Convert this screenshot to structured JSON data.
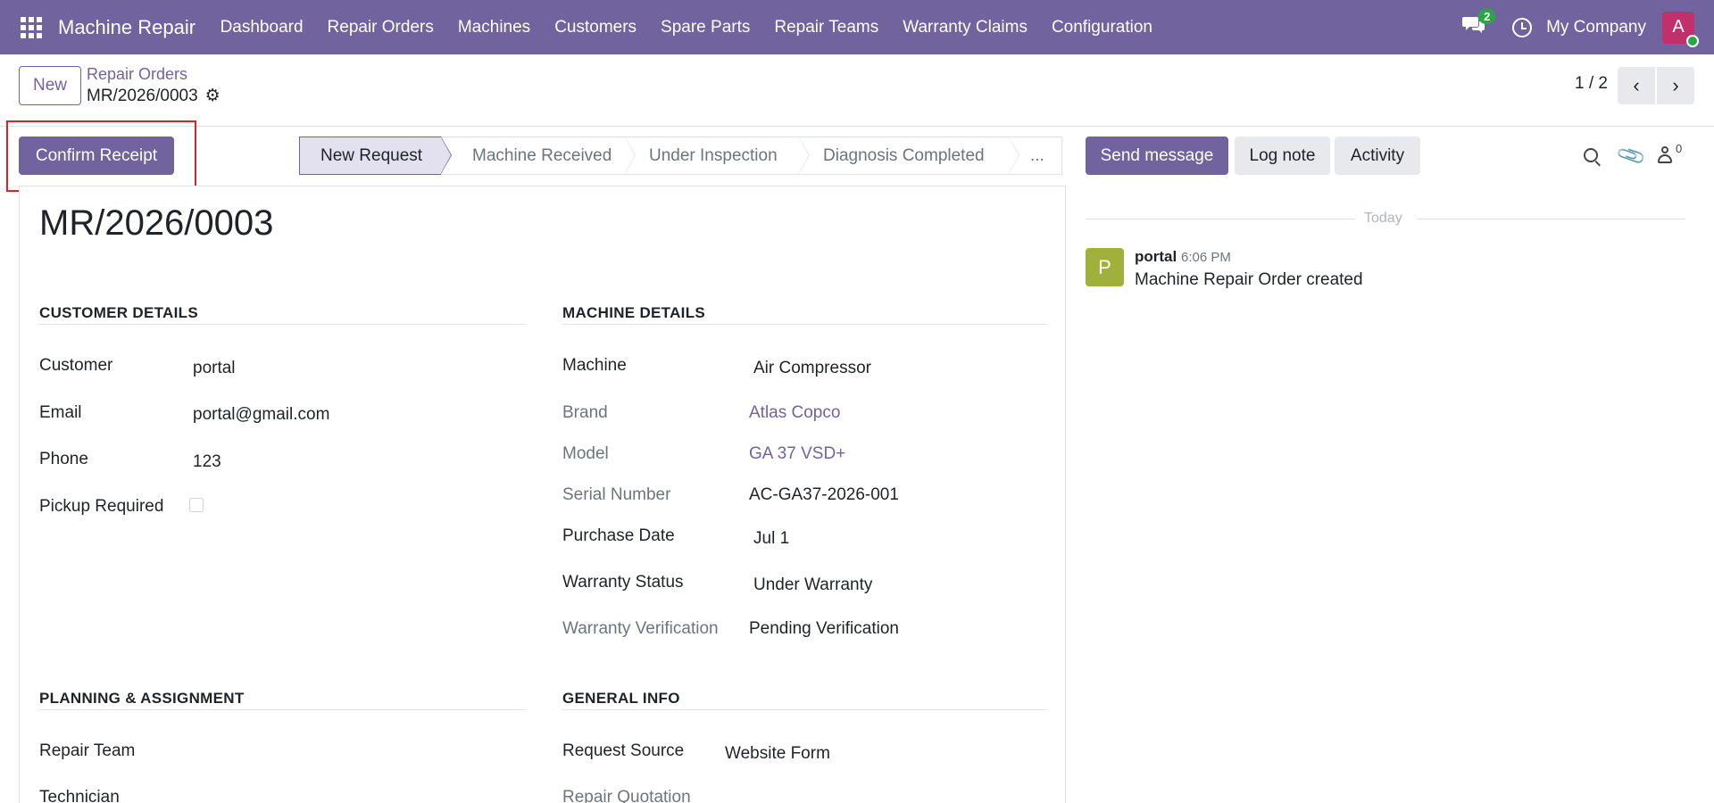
{
  "navbar": {
    "brand": "Machine Repair",
    "menu": [
      "Dashboard",
      "Repair Orders",
      "Machines",
      "Customers",
      "Spare Parts",
      "Repair Teams",
      "Warranty Claims",
      "Configuration"
    ],
    "messages_count": "2",
    "company": "My Company",
    "avatar_letter": "A",
    "colors": {
      "navbar_bg": "#71639e",
      "badge": "#28a745",
      "avatar": "#c2306b"
    }
  },
  "control_panel": {
    "new_label": "New",
    "breadcrumb_parent": "Repair Orders",
    "breadcrumb_current": "MR/2026/0003",
    "pager_value": "1 / 2"
  },
  "actions": {
    "confirm_receipt": "Confirm Receipt"
  },
  "statusbar": {
    "stages": [
      "New Request",
      "Machine Received",
      "Under Inspection",
      "Diagnosis Completed",
      "..."
    ],
    "active_stage": "New Request"
  },
  "form": {
    "title": "MR/2026/0003",
    "customer_details": {
      "heading": "CUSTOMER DETAILS",
      "customer_label": "Customer",
      "customer_value": "portal",
      "email_label": "Email",
      "email_value": "portal@gmail.com",
      "phone_label": "Phone",
      "phone_value": "123",
      "pickup_label": "Pickup Required",
      "pickup_checked": false
    },
    "machine_details": {
      "heading": "MACHINE DETAILS",
      "machine_label": "Machine",
      "machine_value": "Air Compressor",
      "brand_label": "Brand",
      "brand_value": "Atlas Copco",
      "model_label": "Model",
      "model_value": "GA 37 VSD+",
      "serial_label": "Serial Number",
      "serial_value": "AC-GA37-2026-001",
      "purchase_label": "Purchase Date",
      "purchase_value": "Jul 1",
      "warranty_status_label": "Warranty Status",
      "warranty_status_value": "Under Warranty",
      "warranty_verification_label": "Warranty Verification",
      "warranty_verification_value": "Pending Verification"
    },
    "planning": {
      "heading": "PLANNING & ASSIGNMENT",
      "repair_team_label": "Repair Team",
      "technician_label": "Technician"
    },
    "general_info": {
      "heading": "GENERAL INFO",
      "request_source_label": "Request Source",
      "request_source_value": "Website Form",
      "repair_quotation_label": "Repair Quotation"
    }
  },
  "chatter": {
    "send_message": "Send message",
    "log_note": "Log note",
    "activity": "Activity",
    "followers_count": "0",
    "date_separator": "Today",
    "messages": [
      {
        "avatar_letter": "P",
        "author": "portal",
        "time": "6:06 PM",
        "body": "Machine Repair Order created"
      }
    ]
  }
}
